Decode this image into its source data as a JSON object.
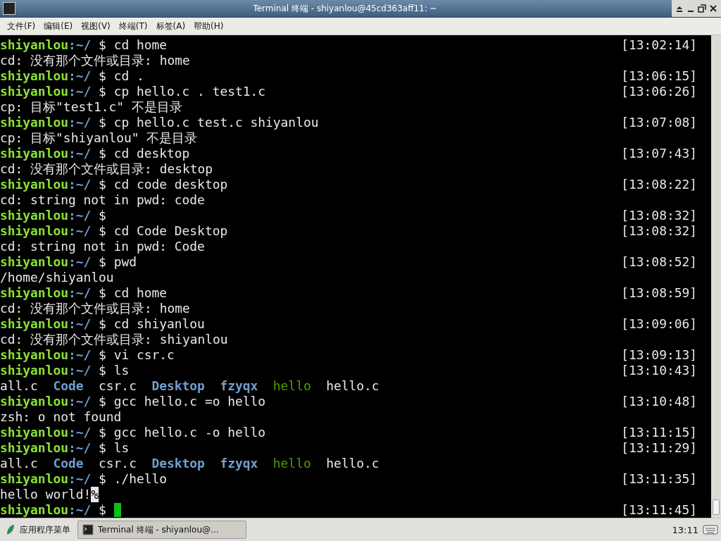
{
  "window": {
    "title": "Terminal 终端 - shiyanlou@45cd363aff11: ~"
  },
  "menu": [
    "文件(F)",
    "编辑(E)",
    "视图(V)",
    "终端(T)",
    "标签(A)",
    "帮助(H)"
  ],
  "terminal": {
    "lines": [
      {
        "kind": "prompt",
        "user": "shiyanlou",
        "path": ":~/",
        "sign": "$",
        "command": "cd home",
        "time": "[13:02:14]"
      },
      {
        "kind": "output",
        "text": "cd: 没有那个文件或目录: home"
      },
      {
        "kind": "prompt",
        "user": "shiyanlou",
        "path": ":~/",
        "sign": "$",
        "command": "cd .",
        "time": "[13:06:15]"
      },
      {
        "kind": "prompt",
        "user": "shiyanlou",
        "path": ":~/",
        "sign": "$",
        "command": "cp hello.c . test1.c",
        "time": "[13:06:26]"
      },
      {
        "kind": "output",
        "text": "cp: 目标\"test1.c\" 不是目录"
      },
      {
        "kind": "prompt",
        "user": "shiyanlou",
        "path": ":~/",
        "sign": "$",
        "command": "cp hello.c test.c shiyanlou",
        "time": "[13:07:08]"
      },
      {
        "kind": "output",
        "text": "cp: 目标\"shiyanlou\" 不是目录"
      },
      {
        "kind": "prompt",
        "user": "shiyanlou",
        "path": ":~/",
        "sign": "$",
        "command": "cd desktop",
        "time": "[13:07:43]"
      },
      {
        "kind": "output",
        "text": "cd: 没有那个文件或目录: desktop"
      },
      {
        "kind": "prompt",
        "user": "shiyanlou",
        "path": ":~/",
        "sign": "$",
        "command": "cd code desktop",
        "time": "[13:08:22]"
      },
      {
        "kind": "output",
        "text": "cd: string not in pwd: code"
      },
      {
        "kind": "prompt",
        "user": "shiyanlou",
        "path": ":~/",
        "sign": "$",
        "time": "[13:08:32]"
      },
      {
        "kind": "prompt",
        "user": "shiyanlou",
        "path": ":~/",
        "sign": "$",
        "command": "cd Code Desktop",
        "time": "[13:08:32]"
      },
      {
        "kind": "output",
        "text": "cd: string not in pwd: Code"
      },
      {
        "kind": "prompt",
        "user": "shiyanlou",
        "path": ":~/",
        "sign": "$",
        "command": "pwd",
        "time": "[13:08:52]"
      },
      {
        "kind": "output",
        "text": "/home/shiyanlou"
      },
      {
        "kind": "prompt",
        "user": "shiyanlou",
        "path": ":~/",
        "sign": "$",
        "command": "cd home",
        "time": "[13:08:59]"
      },
      {
        "kind": "output",
        "text": "cd: 没有那个文件或目录: home"
      },
      {
        "kind": "prompt",
        "user": "shiyanlou",
        "path": ":~/",
        "sign": "$",
        "command": "cd shiyanlou",
        "time": "[13:09:06]"
      },
      {
        "kind": "output",
        "text": "cd: 没有那个文件或目录: shiyanlou"
      },
      {
        "kind": "prompt",
        "user": "shiyanlou",
        "path": ":~/",
        "sign": "$",
        "command": "vi csr.c",
        "time": "[13:09:13]"
      },
      {
        "kind": "prompt",
        "user": "shiyanlou",
        "path": ":~/",
        "sign": "$",
        "command": "ls",
        "time": "[13:10:43]"
      },
      {
        "kind": "listing",
        "entries": [
          {
            "name": "all.c",
            "kind": "file"
          },
          {
            "name": "Code",
            "kind": "dir"
          },
          {
            "name": "csr.c",
            "kind": "file"
          },
          {
            "name": "Desktop",
            "kind": "dir"
          },
          {
            "name": "fzyqx",
            "kind": "dir"
          },
          {
            "name": "hello",
            "kind": "exec"
          },
          {
            "name": "hello.c",
            "kind": "file"
          }
        ]
      },
      {
        "kind": "prompt",
        "user": "shiyanlou",
        "path": ":~/",
        "sign": "$",
        "command": "gcc hello.c =o hello",
        "time": "[13:10:48]"
      },
      {
        "kind": "output",
        "text": "zsh: o not found"
      },
      {
        "kind": "prompt",
        "user": "shiyanlou",
        "path": ":~/",
        "sign": "$",
        "command": "gcc hello.c -o hello",
        "time": "[13:11:15]"
      },
      {
        "kind": "prompt",
        "user": "shiyanlou",
        "path": ":~/",
        "sign": "$",
        "command": "ls",
        "time": "[13:11:29]"
      },
      {
        "kind": "listing",
        "entries": [
          {
            "name": "all.c",
            "kind": "file"
          },
          {
            "name": "Code",
            "kind": "dir"
          },
          {
            "name": "csr.c",
            "kind": "file"
          },
          {
            "name": "Desktop",
            "kind": "dir"
          },
          {
            "name": "fzyqx",
            "kind": "dir"
          },
          {
            "name": "hello",
            "kind": "exec"
          },
          {
            "name": "hello.c",
            "kind": "file"
          }
        ]
      },
      {
        "kind": "prompt",
        "user": "shiyanlou",
        "path": ":~/",
        "sign": "$",
        "command": "./hello",
        "time": "[13:11:35]"
      },
      {
        "kind": "output",
        "text": "hello world!",
        "eol_mark": "%"
      },
      {
        "kind": "prompt",
        "user": "shiyanlou",
        "path": ":~/",
        "sign": "$",
        "cursor": true,
        "time": "[13:11:45]"
      }
    ]
  },
  "taskbar": {
    "app_menu": "应用程序菜单",
    "tasks": [
      {
        "label": "Terminal 终端 - shiyanlou@…",
        "selected": true
      }
    ],
    "clock": "13:11"
  }
}
